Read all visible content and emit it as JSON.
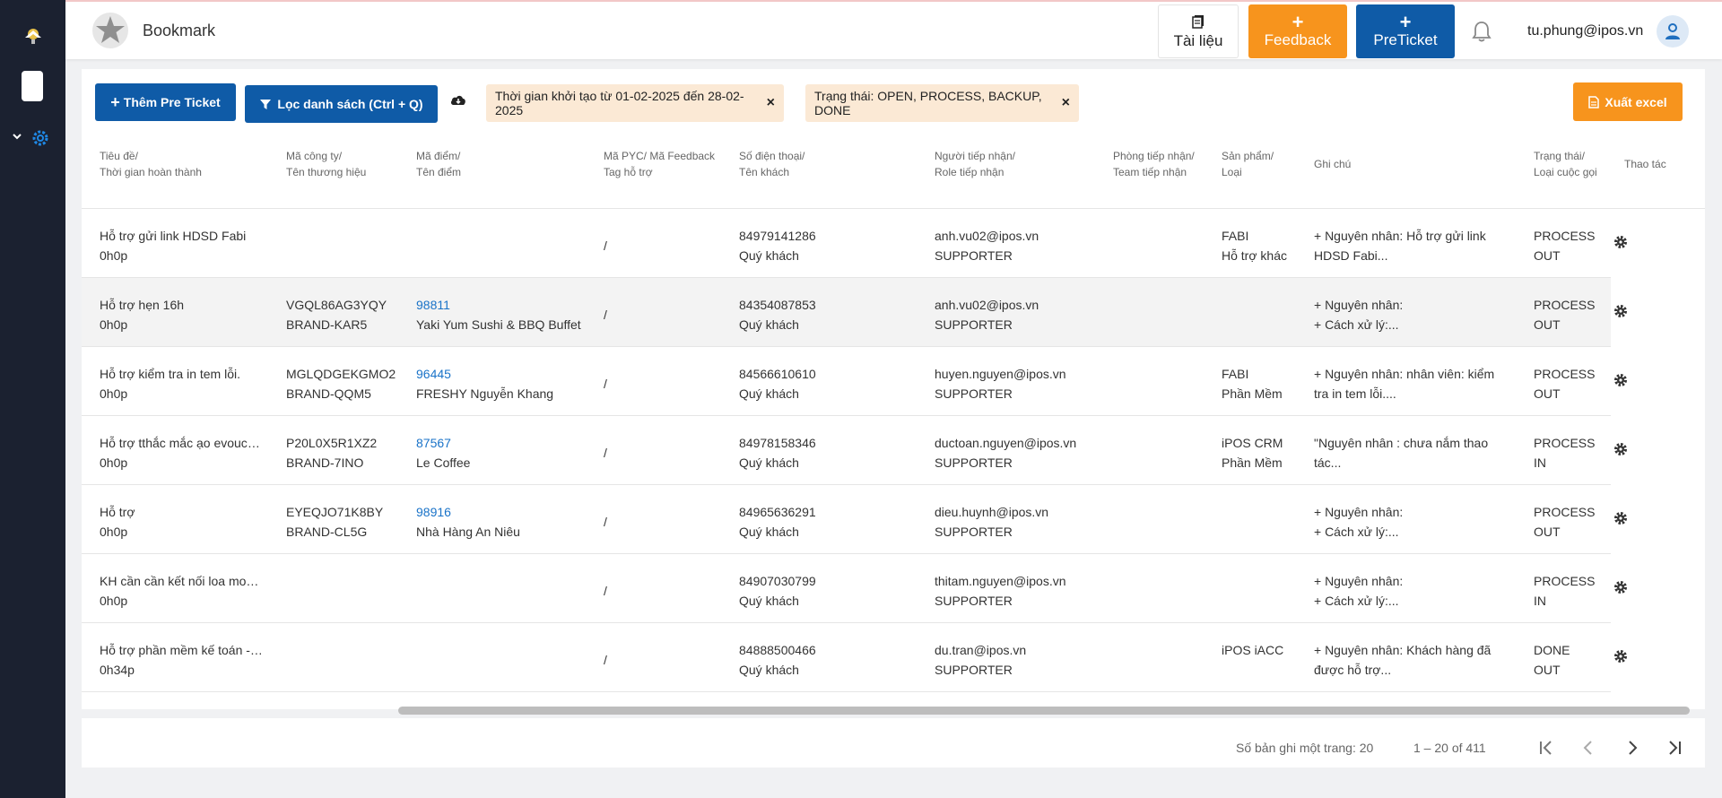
{
  "header": {
    "title": "Bookmark",
    "docs_label": "Tài liệu",
    "feedback_label": "Feedback",
    "preticket_label": "PreTicket",
    "plus": "+",
    "user_email": "tu.phung@ipos.vn"
  },
  "toolbar": {
    "add_label": "Thêm Pre Ticket",
    "filter_label": "Lọc danh sách (Ctrl + Q)",
    "chip_time": "Thời gian khởi tạo từ 01-02-2025 đến 28-02-2025",
    "chip_status": "Trạng thái: OPEN, PROCESS, BACKUP, DONE",
    "chip_close": "×",
    "excel_label": "Xuất excel"
  },
  "columns": {
    "c1a": "Tiêu đề/",
    "c1b": "Thời gian hoàn thành",
    "c2a": "Mã công ty/",
    "c2b": "Tên thương hiệu",
    "c3a": "Mã điểm/",
    "c3b": "Tên điểm",
    "c4a": "Mã PYC/ Mã Feedback",
    "c4b": "Tag hỗ trợ",
    "c5a": "Số điện thoại/",
    "c5b": "Tên khách",
    "c6a": "Người tiếp nhận/",
    "c6b": "Role tiếp nhận",
    "c7a": "Phòng tiếp nhận/",
    "c7b": "Team tiếp nhận",
    "c8a": "Sản phẩm/",
    "c8b": "Loại",
    "c9": "Ghi chú",
    "c10a": "Trạng thái/",
    "c10b": "Loại cuộc gọi",
    "c11": "Thao tác"
  },
  "rows": [
    {
      "title": "Hỗ trợ gửi link HDSD Fabi",
      "time": "0h0p",
      "company": "",
      "brand": "",
      "store_code": "",
      "store_name": "",
      "pyc": "/",
      "phone": "84979141286",
      "customer": "Quý khách",
      "receiver": "anh.vu02@ipos.vn",
      "role": "SUPPORTER",
      "product": "FABI",
      "type": "Hỗ trợ khác",
      "note1": "+ Nguyên nhân: Hỗ trợ gửi link",
      "note2": "HDSD Fabi...",
      "status": "PROCESS",
      "call": "OUT"
    },
    {
      "title": "Hỗ trợ hẹn 16h",
      "time": "0h0p",
      "company": "VGQL86AG3YQY",
      "brand": "BRAND-KAR5",
      "store_code": "98811",
      "store_name": "Yaki Yum Sushi & BBQ Buffet",
      "pyc": "/",
      "phone": "84354087853",
      "customer": "Quý khách",
      "receiver": "anh.vu02@ipos.vn",
      "role": "SUPPORTER",
      "product": "",
      "type": "",
      "note1": "+ Nguyên nhân:",
      "note2": "+ Cách xử lý:...",
      "status": "PROCESS",
      "call": "OUT"
    },
    {
      "title": "Hỗ trợ kiểm tra in tem lỗi.",
      "time": "0h0p",
      "company": "MGLQDGEKGMO2",
      "brand": "BRAND-QQM5",
      "store_code": "96445",
      "store_name": "FRESHY Nguyễn Khang",
      "pyc": "/",
      "phone": "84566610610",
      "customer": "Quý khách",
      "receiver": "huyen.nguyen@ipos.vn",
      "role": "SUPPORTER",
      "product": "FABI",
      "type": "Phần Mềm",
      "note1": "+ Nguyên nhân: nhân viên: kiểm",
      "note2": "tra in tem lỗi....",
      "status": "PROCESS",
      "call": "OUT"
    },
    {
      "title": "Hỗ trợ tthắc mắc ạo evoucher",
      "time": "0h0p",
      "company": "P20L0X5R1XZ2",
      "brand": "BRAND-7INO",
      "store_code": "87567",
      "store_name": "Le Coffee",
      "pyc": "/",
      "phone": "84978158346",
      "customer": "Quý khách",
      "receiver": "ductoan.nguyen@ipos.vn",
      "role": "SUPPORTER",
      "product": "iPOS CRM",
      "type": "Phần Mềm",
      "note1": "\"Nguyên nhân : chưa nắm thao",
      "note2": "tác...",
      "status": "PROCESS",
      "call": "IN"
    },
    {
      "title": "Hỗ trợ",
      "time": "0h0p",
      "company": "EYEQJO71K8BY",
      "brand": "BRAND-CL5G",
      "store_code": "98916",
      "store_name": "Nhà Hàng An Niêu",
      "pyc": "/",
      "phone": "84965636291",
      "customer": "Quý khách",
      "receiver": "dieu.huynh@ipos.vn",
      "role": "SUPPORTER",
      "product": "",
      "type": "",
      "note1": "+ Nguyên nhân:",
      "note2": "+ Cách xử lý:...",
      "status": "PROCESS",
      "call": "OUT"
    },
    {
      "title": "KH cần cần kết nối loa mobile",
      "time": "0h0p",
      "company": "",
      "brand": "",
      "store_code": "",
      "store_name": "",
      "pyc": "/",
      "phone": "84907030799",
      "customer": "Quý khách",
      "receiver": "thitam.nguyen@ipos.vn",
      "role": "SUPPORTER",
      "product": "",
      "type": "",
      "note1": "+ Nguyên nhân:",
      "note2": "+ Cách xử lý:...",
      "status": "PROCESS",
      "call": "IN"
    },
    {
      "title": "Hỗ trợ phần mềm kế toán - iACC",
      "time": "0h34p",
      "company": "",
      "brand": "",
      "store_code": "",
      "store_name": "",
      "pyc": "/",
      "phone": "84888500466",
      "customer": "Quý khách",
      "receiver": "du.tran@ipos.vn",
      "role": "SUPPORTER",
      "product": "iPOS iACC",
      "type": "",
      "note1": "+ Nguyên nhân: Khách hàng đã",
      "note2": "được hỗ trợ...",
      "status": "DONE",
      "call": "OUT"
    }
  ],
  "footer": {
    "page_size": "Số bản ghi một trang: 20",
    "range": "1 – 20 of 411"
  },
  "colors": {
    "primary": "#0f5ba7",
    "accent": "#f7941d",
    "chip_bg": "#fbe9d5",
    "sidebar": "#1b2130",
    "link": "#1a73c8"
  },
  "icons": {
    "sidebar": [
      "app-logo-icon",
      "chevron-down-icon",
      "gear-icon"
    ],
    "header": [
      "star-icon",
      "document-icon",
      "bell-icon",
      "user-icon"
    ],
    "toolbar": [
      "filter-icon",
      "cloud-download-icon",
      "excel-icon"
    ]
  }
}
